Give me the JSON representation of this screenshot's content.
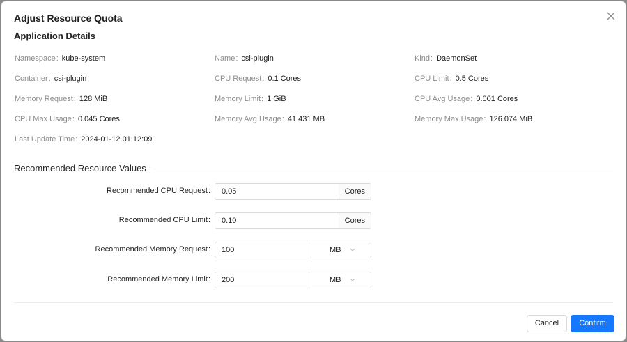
{
  "dialog": {
    "title": "Adjust Resource Quota",
    "close_icon": "close-icon"
  },
  "details": {
    "title": "Application Details",
    "colon": ":",
    "fields": [
      {
        "key": "Namespace",
        "value": "kube-system"
      },
      {
        "key": "Name",
        "value": "csi-plugin"
      },
      {
        "key": "Kind",
        "value": "DaemonSet"
      },
      {
        "key": "Container",
        "value": "csi-plugin"
      },
      {
        "key": "CPU Request",
        "value": "0.1 Cores"
      },
      {
        "key": "CPU Limit",
        "value": "0.5 Cores"
      },
      {
        "key": "Memory Request",
        "value": "128 MiB"
      },
      {
        "key": "Memory Limit",
        "value": "1 GiB"
      },
      {
        "key": "CPU Avg Usage",
        "value": "0.001 Cores"
      },
      {
        "key": "CPU Max Usage",
        "value": "0.045 Cores"
      },
      {
        "key": "Memory Avg Usage",
        "value": "41.431 MB"
      },
      {
        "key": "Memory Max Usage",
        "value": "126.074 MiB"
      },
      {
        "key": "Last Update Time",
        "value": "2024-01-12 01:12:09"
      }
    ]
  },
  "recommended": {
    "title": "Recommended Resource Values",
    "colon": ":",
    "rows": [
      {
        "label": "Recommended CPU Request",
        "value": "0.05",
        "unit": "Cores",
        "unit_type": "addon"
      },
      {
        "label": "Recommended CPU Limit",
        "value": "0.10",
        "unit": "Cores",
        "unit_type": "addon"
      },
      {
        "label": "Recommended Memory Request",
        "value": "100",
        "unit": "MB",
        "unit_type": "select"
      },
      {
        "label": "Recommended Memory Limit",
        "value": "200",
        "unit": "MB",
        "unit_type": "select"
      }
    ]
  },
  "footer": {
    "cancel_label": "Cancel",
    "confirm_label": "Confirm"
  },
  "colors": {
    "primary": "#1677ff",
    "label_gray": "#8c8c8c",
    "text": "#1f1f1f"
  }
}
